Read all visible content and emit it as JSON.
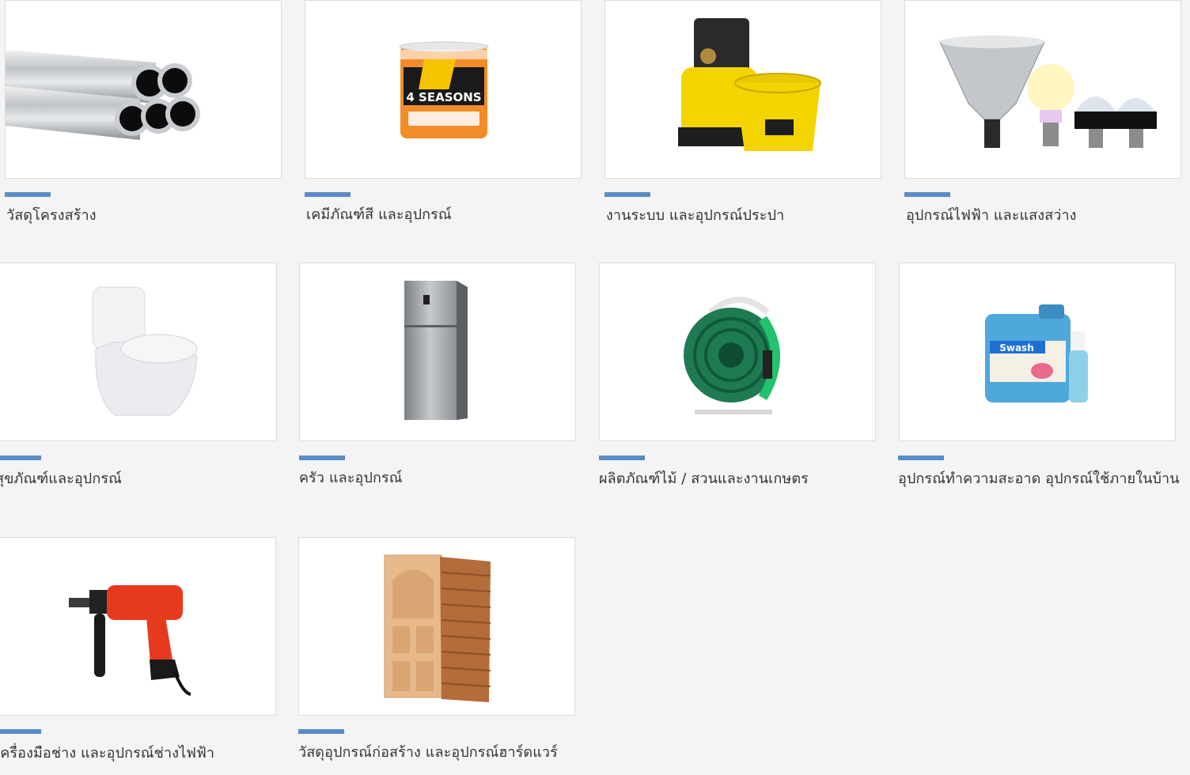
{
  "theme": {
    "accent_color": "#5b8cc7",
    "background": "#f4f4f4",
    "card_background": "#ffffff",
    "text_color": "#333333"
  },
  "categories": [
    {
      "label": "วัสดุโครงสร้าง",
      "icon": "steel-pipes-icon"
    },
    {
      "label": "เคมีภัณฑ์สี และอุปกรณ์",
      "icon": "paint-bucket-icon",
      "brand_text": "4 SEASONS"
    },
    {
      "label": "งานระบบ และอุปกรณ์ประปา",
      "icon": "water-pump-icon"
    },
    {
      "label": "อุปกรณ์ไฟฟ้า และแสงสว่าง",
      "icon": "light-bulbs-icon"
    },
    {
      "label": "สุขภัณฑ์และอุปกรณ์",
      "icon": "toilet-icon"
    },
    {
      "label": "ครัว และอุปกรณ์",
      "icon": "refrigerator-icon"
    },
    {
      "label": "ผลิตภัณฑ์ไม้ / สวนและงานเกษตร",
      "icon": "garden-hose-reel-icon"
    },
    {
      "label": "อุปกรณ์ทำความสะอาด อุปกรณ์ใช้ภายในบ้าน",
      "icon": "cleaning-products-icon",
      "brand_text": "Swash"
    },
    {
      "label": "เครื่องมือช่าง และอุปกรณ์ช่างไฟฟ้า",
      "icon": "power-drill-icon"
    },
    {
      "label": "วัสดุอุปกรณ์ก่อสร้าง และอุปกรณ์ฮาร์ดแวร์",
      "icon": "wooden-doors-icon"
    }
  ]
}
